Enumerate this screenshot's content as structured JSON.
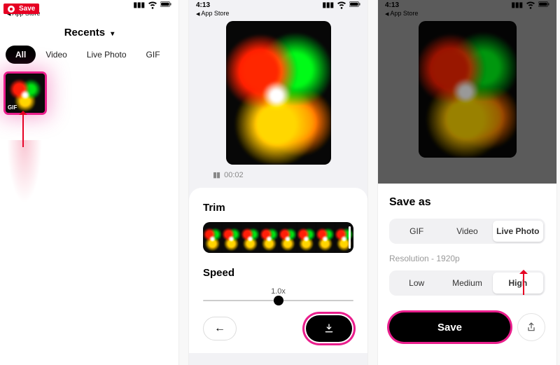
{
  "screen1": {
    "save_badge": "Save",
    "app_back": "App Store",
    "header": "Recents",
    "tabs": {
      "all": "All",
      "video": "Video",
      "live": "Live Photo",
      "gif": "GIF"
    },
    "thumb_badge": "GIF"
  },
  "screen2": {
    "time": "4:13",
    "app_back": "App Store",
    "play_time": "00:02",
    "trim_title": "Trim",
    "speed_title": "Speed",
    "speed_value": "1.0x"
  },
  "screen3": {
    "time": "4:13",
    "app_back": "App Store",
    "sheet_title": "Save as",
    "formats": {
      "gif": "GIF",
      "video": "Video",
      "live": "Live Photo"
    },
    "resolution_label": "Resolution - 1920p",
    "quality": {
      "low": "Low",
      "medium": "Medium",
      "high": "High"
    },
    "save_button": "Save"
  }
}
